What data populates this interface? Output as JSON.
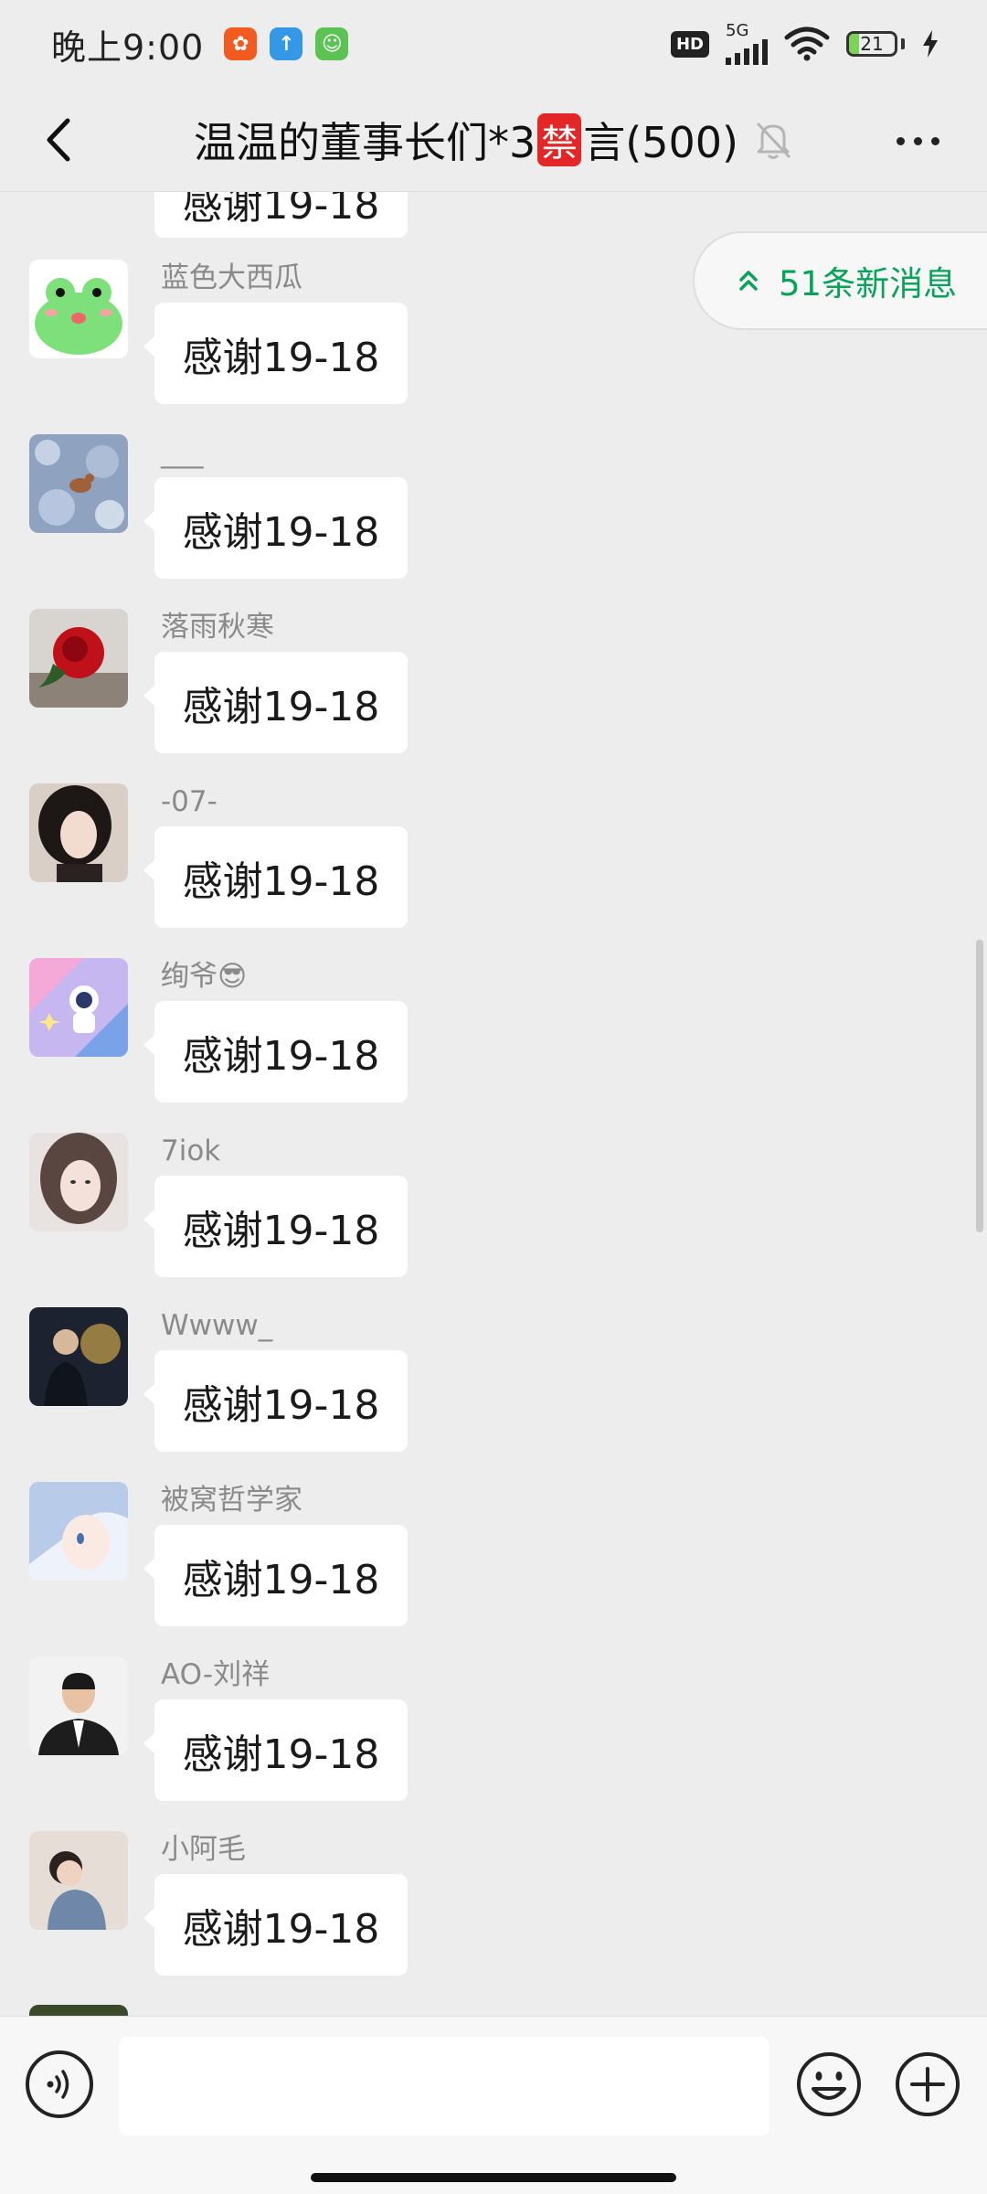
{
  "status_bar": {
    "time": "晚上9:00",
    "network": "5G",
    "hd": "HD",
    "battery": "21",
    "battery_level_percent": 21
  },
  "header": {
    "title_prefix": "温温的董事长们*3",
    "title_ban": "禁",
    "title_suffix": "言(500)",
    "back_icon": "chevron-left-icon",
    "mute_icon": "bell-off-icon",
    "more_icon": "more-dots-icon"
  },
  "new_messages_badge": "51条新消息",
  "partial_message": "感谢19-18",
  "messages": [
    {
      "sender": "蓝色大西瓜",
      "text": "感谢19-18"
    },
    {
      "sender": "___",
      "text": "感谢19-18"
    },
    {
      "sender": "落雨秋寒",
      "text": "感谢19-18"
    },
    {
      "sender": "-07-",
      "text": "感谢19-18"
    },
    {
      "sender": "绚爷😎",
      "text": "感谢19-18"
    },
    {
      "sender": "7iok",
      "text": "感谢19-18"
    },
    {
      "sender": "Wwww_",
      "text": "感谢19-18"
    },
    {
      "sender": "被窝哲学家",
      "text": "感谢19-18"
    },
    {
      "sender": "AO-刘祥",
      "text": "感谢19-18"
    },
    {
      "sender": "小阿毛",
      "text": "感谢19-18"
    }
  ],
  "input_bar": {
    "text_value": "",
    "voice_icon": "voice-icon",
    "emoji_icon": "emoji-icon",
    "plus_icon": "plus-circle-icon"
  },
  "colors": {
    "background": "#ededed",
    "accent_green": "#07a35a",
    "bubble": "#ffffff",
    "ban_red": "#e32626"
  }
}
